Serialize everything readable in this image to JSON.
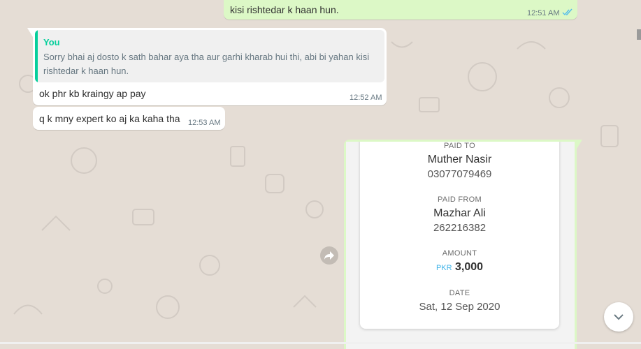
{
  "colors": {
    "chat_background": "#e5ddd5",
    "outgoing_bubble": "#dcf8c6",
    "incoming_bubble": "#ffffff",
    "quote_accent": "#06cf9c",
    "read_ticks": "#53bdeb",
    "currency_accent": "#3fb3e8"
  },
  "messages": [
    {
      "direction": "outgoing",
      "text": "kisi rishtedar k haan hun.",
      "time": "12:51 AM",
      "status_icon": "double-check-read-icon"
    },
    {
      "direction": "incoming",
      "quoted": {
        "author": "You",
        "text": "Sorry bhai aj dosto k sath bahar aya tha aur garhi kharab hui thi, abi bi yahan kisi rishtedar k haan hun."
      },
      "text": "ok phr kb kraingy ap pay",
      "time": "12:52 AM"
    },
    {
      "direction": "incoming",
      "text": "q k mny expert ko aj ka kaha tha",
      "time": "12:53 AM"
    }
  ],
  "receipt": {
    "paid_to_label": "PAID TO",
    "paid_to_name": "Muther Nasir",
    "paid_to_number": "03077079469",
    "paid_from_label": "PAID FROM",
    "paid_from_name": "Mazhar Ali",
    "paid_from_number": "262216382",
    "amount_label": "AMOUNT",
    "currency": "PKR",
    "amount": "3,000",
    "date_label": "DATE",
    "date": "Sat, 12 Sep 2020"
  },
  "controls": {
    "forward_icon": "forward-arrow-icon",
    "scroll_down_icon": "chevron-down-icon"
  }
}
